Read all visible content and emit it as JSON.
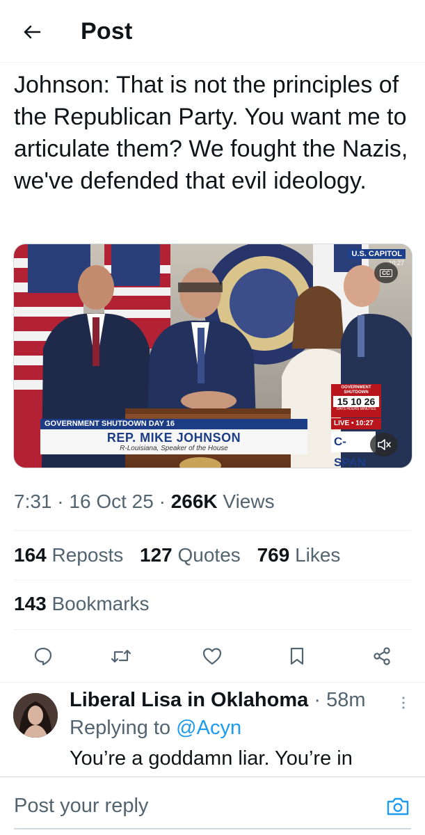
{
  "header": {
    "back_icon": "arrow-left-icon",
    "title": "Post"
  },
  "tweet": {
    "text": "Johnson: That is not the principles of the Republican Party. You want me to articulate them? We fought the Nazis, we've defended that evil ideology.",
    "media": {
      "bug_label": "U.S. CAPITOL",
      "bug_time": "10:27",
      "cc_label": "CC",
      "chyron_tag": "GOVERNMENT SHUTDOWN DAY 16",
      "chyron_name": "REP. MIKE JOHNSON",
      "chyron_sub": "R-Louisiana, Speaker of the House",
      "clock_head": "GOVERNMENT SHUTDOWN",
      "clock_values": "15 10 26",
      "clock_units": "DAYS  HOURS  MINUTES",
      "live_label": "LIVE • 10:27",
      "network": "C-SPAN",
      "mute_icon": "speaker-muted-icon"
    },
    "time": "7:31",
    "date": "16 Oct 25",
    "views_count": "266K",
    "views_label": "Views",
    "reposts_count": "164",
    "reposts_label": "Reposts",
    "quotes_count": "127",
    "quotes_label": "Quotes",
    "likes_count": "769",
    "likes_label": "Likes",
    "bookmarks_count": "143",
    "bookmarks_label": "Bookmarks"
  },
  "actions": [
    "reply-icon",
    "repost-icon",
    "like-icon",
    "bookmark-icon",
    "share-icon"
  ],
  "reply": {
    "name": "Liberal Lisa in Oklahoma",
    "time": "58m",
    "replying_prefix": "Replying to",
    "mention": "@Acyn",
    "text": "You’re a goddamn liar. You’re in"
  },
  "composer": {
    "placeholder": "Post your reply",
    "camera_icon": "camera-icon"
  },
  "colors": {
    "accent": "#1d9bf0",
    "text": "#0f1419",
    "secondary": "#536471",
    "border": "#eff3f4"
  }
}
